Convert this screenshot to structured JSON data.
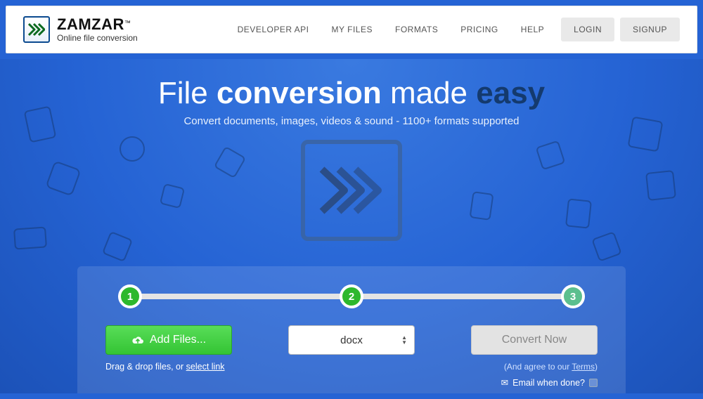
{
  "brand": {
    "name": "ZAMZAR",
    "tm": "™",
    "tagline": "Online file conversion"
  },
  "nav": {
    "items": [
      "DEVELOPER API",
      "MY FILES",
      "FORMATS",
      "PRICING",
      "HELP"
    ],
    "login": "LOGIN",
    "signup": "SIGNUP"
  },
  "hero": {
    "headline_parts": {
      "a": "File ",
      "b": "conversion",
      "c": " made ",
      "d": "easy"
    },
    "subhead": "Convert documents, images, videos & sound - 1100+ formats supported"
  },
  "steps": {
    "labels": [
      "1",
      "2",
      "3"
    ]
  },
  "converter": {
    "add_files_label": "Add Files...",
    "drag_hint_pre": "Drag & drop files, or ",
    "drag_hint_link": "select link",
    "format_selected": "docx",
    "convert_label": "Convert Now",
    "agree_pre": "(And agree to our ",
    "agree_link": "Terms",
    "agree_post": ")",
    "email_label": "Email when done?",
    "email_checked": false
  }
}
